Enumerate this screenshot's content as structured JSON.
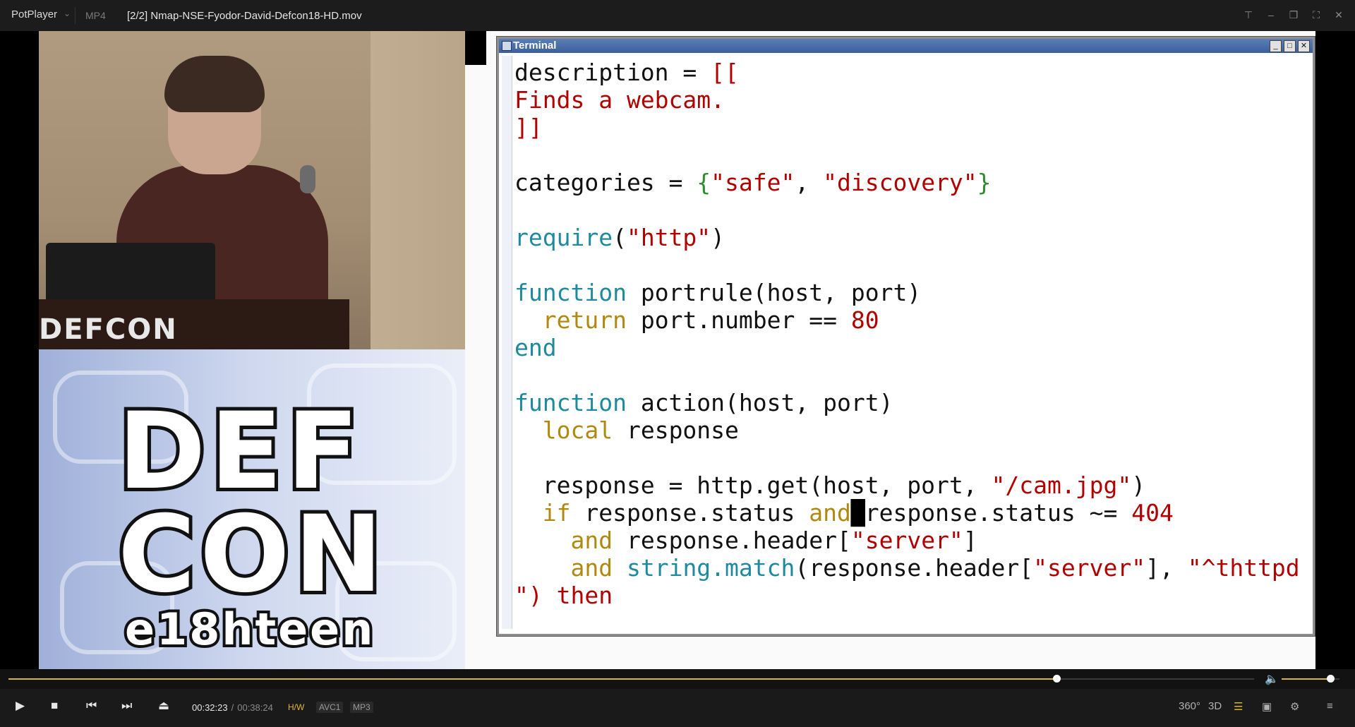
{
  "titlebar": {
    "app": "PotPlayer",
    "chevron": "⌄",
    "format": "MP4",
    "file": "[2/2] Nmap-NSE-Fyodor-David-Defcon18-HD.mov",
    "buttons": [
      "pin-icon",
      "minimize-icon",
      "restore-icon",
      "fullscreen-icon",
      "close-icon"
    ]
  },
  "video": {
    "podium_logo": "DEFCON",
    "logo_line1": "DEF",
    "logo_line2": "CON",
    "logo_line3": "e18hteen"
  },
  "terminal": {
    "title": "Terminal",
    "code_lines": [
      "description = [[",
      "Finds a webcam.",
      "]]",
      "",
      "categories = {\"safe\", \"discovery\"}",
      "",
      "require(\"http\")",
      "",
      "function portrule(host, port)",
      "  return port.number == 80",
      "end",
      "",
      "function action(host, port)",
      "  local response",
      "",
      "  response = http.get(host, port, \"/cam.jpg\")",
      "  if response.status and response.status ~= 404",
      "    and response.header[\"server\"]",
      "    and string.match(response.header[\"server\"], \"^thttpd",
      "\") then"
    ]
  },
  "playback": {
    "progress": 0.8416,
    "volume": 0.84,
    "current_time": "00:32:23",
    "total_time": "00:38:24",
    "hw_badge": "H/W",
    "video_codec": "AVC1",
    "audio_codec": "MP3",
    "right_controls": [
      "360°",
      "3D"
    ]
  },
  "colors": {
    "accent": "#d9b62b",
    "string": "#b10000",
    "keyword": "#1f8a9e",
    "control": "#b08a10"
  }
}
